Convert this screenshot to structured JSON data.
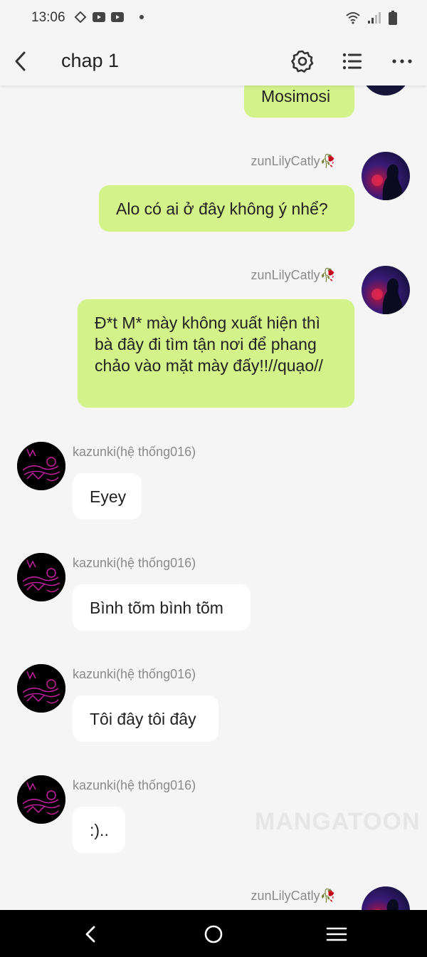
{
  "status_bar": {
    "time": "13:06",
    "left_icons": [
      "diamond-icon",
      "youtube-icon",
      "youtube-icon"
    ],
    "right_icons": [
      "wifi-icon",
      "signal-icon",
      "battery-icon"
    ]
  },
  "header": {
    "title": "chap 1",
    "actions": [
      "settings-icon",
      "list-icon",
      "more-icon"
    ]
  },
  "messages": [
    {
      "side": "right",
      "text": "Mosimosi"
    },
    {
      "side": "right",
      "sender": "zunLilyCatly🥀",
      "text": "Alo có ai ở đây không ý nhể?"
    },
    {
      "side": "right",
      "sender": "zunLilyCatly🥀",
      "text": "Đ*t M* mày không xuất hiện thì bà đây đi tìm tận nơi để phang chảo vào mặt mày đấy!!//quạo//"
    },
    {
      "side": "left",
      "sender": "kazunki(hệ thống016)",
      "text": "Eyey"
    },
    {
      "side": "left",
      "sender": "kazunki(hệ thống016)",
      "text": "Bình tõm bình tõm"
    },
    {
      "side": "left",
      "sender": "kazunki(hệ thống016)",
      "text": "Tôi đây tôi đây"
    },
    {
      "side": "left",
      "sender": "kazunki(hệ thống016)",
      "text": ":).."
    },
    {
      "side": "right",
      "sender": "zunLilyCatly🥀"
    }
  ],
  "watermark": "MANGATOON",
  "nav_bar": [
    "back-icon",
    "home-icon",
    "menu-icon"
  ],
  "colors": {
    "my_bubble": "#d3f28a",
    "their_bubble": "#ffffff",
    "background": "#f5f5f5"
  }
}
